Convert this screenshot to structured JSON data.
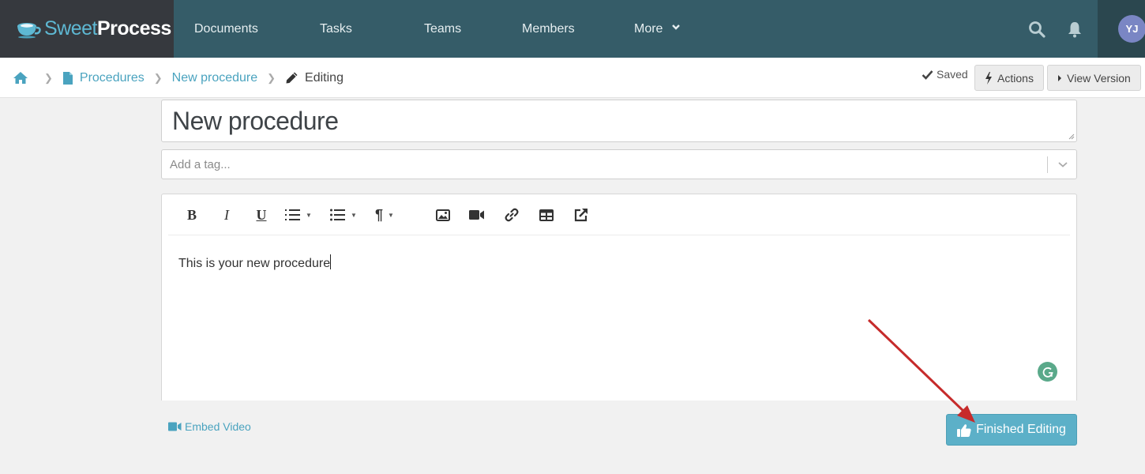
{
  "app": {
    "brand_light": "Sweet",
    "brand_bold": "Process"
  },
  "nav": {
    "items": [
      {
        "label": "Documents"
      },
      {
        "label": "Tasks"
      },
      {
        "label": "Teams"
      },
      {
        "label": "Members"
      },
      {
        "label": "More"
      }
    ],
    "user_initials": "YJ"
  },
  "breadcrumb": {
    "items": [
      {
        "label": "Procedures"
      },
      {
        "label": "New procedure"
      }
    ],
    "current": "Editing"
  },
  "status": {
    "saved_label": "Saved"
  },
  "actions": {
    "actions_label": "Actions",
    "view_version_label": "View Version"
  },
  "procedure": {
    "title": "New procedure",
    "tag_placeholder": "Add a tag...",
    "tag_value": "",
    "body_text": "This is your new procedure"
  },
  "editor_toolbar": {
    "bold": "B",
    "italic": "I",
    "underline": "U",
    "paragraph": "¶"
  },
  "footer": {
    "embed_video_label": "Embed Video",
    "finished_editing_label": "Finished Editing"
  },
  "colors": {
    "navbar": "#355c68",
    "brand_bg": "#36393e",
    "accent": "#4aa3bf",
    "primary_button": "#5cb0c8",
    "annotation_arrow": "#c62b2b",
    "avatar": "#7a86c4"
  }
}
